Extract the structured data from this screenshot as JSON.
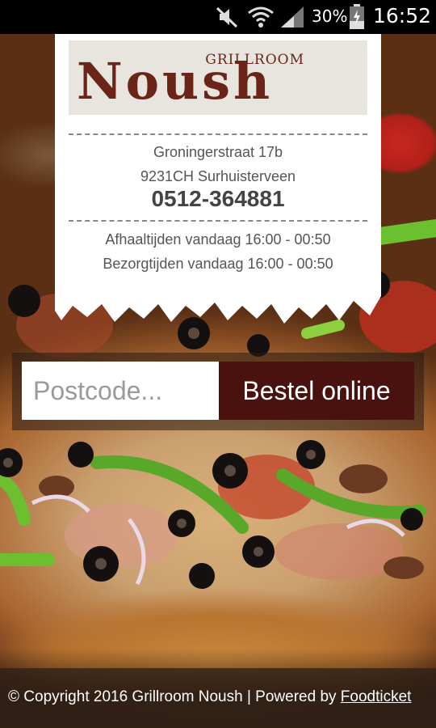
{
  "status_bar": {
    "battery_percent": "30%",
    "time": "16:52",
    "icons": [
      "mute-icon",
      "wifi-icon",
      "signal-icon",
      "battery-icon"
    ]
  },
  "restaurant": {
    "logo_small": "GRILLROOM",
    "logo_big": "Noush",
    "street": "Groningerstraat 17b",
    "city": "9231CH Surhuisterveen",
    "phone": "0512-364881",
    "pickup_hours": "Afhaaltijden vandaag 16:00 - 00:50",
    "delivery_hours": "Bezorgtijden vandaag 16:00 - 00:50"
  },
  "order": {
    "postcode_placeholder": "Postcode...",
    "postcode_value": "",
    "button_label": "Bestel online"
  },
  "footer": {
    "copyright": "© Copyright 2016 Grillroom Noush | Powered by ",
    "link_label": "Foodticket"
  },
  "colors": {
    "brand": "#6a2418",
    "button": "#4a120e"
  }
}
